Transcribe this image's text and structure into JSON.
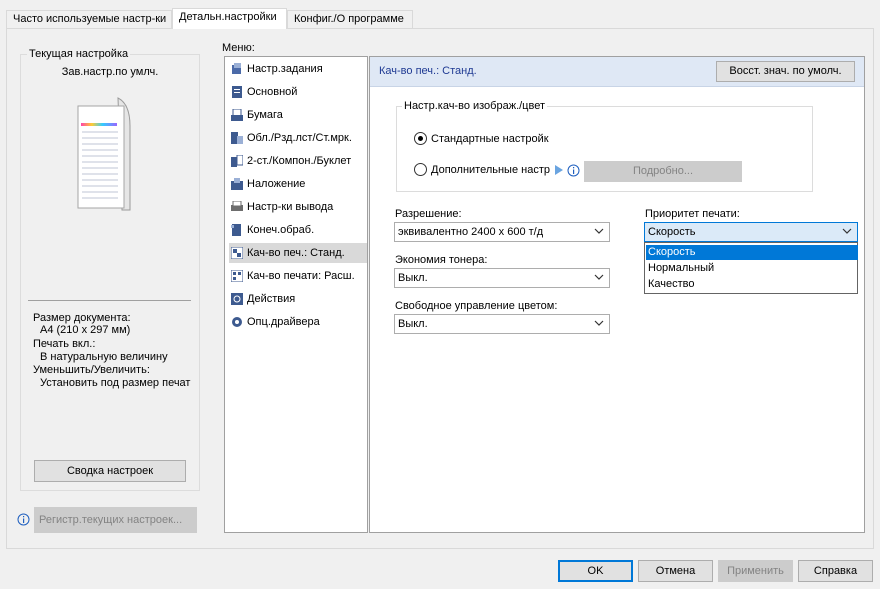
{
  "tabs": [
    {
      "label": "Часто используемые настр-ки",
      "active": false
    },
    {
      "label": "Детальн.настройки",
      "active": true
    },
    {
      "label": "Конфиг./О программе",
      "active": false
    }
  ],
  "left": {
    "current_setting_title": "Текущая настройка",
    "current_setting_value": "Зав.настр.по умлч.",
    "doc_size_label": "Размер документа:",
    "doc_size_value": "A4 (210 x 297 мм)",
    "print_label": "Печать вкл.:",
    "print_value": "В натуральную величину",
    "zoom_label": "Уменьшить/Увеличить:",
    "zoom_value": "Установить под размер печат",
    "summary_button": "Сводка настроек",
    "register_button": "Регистр.текущих настроек..."
  },
  "menu": {
    "title": "Меню:",
    "items": [
      {
        "label": "Настр.задания",
        "icon": "job-settings-icon"
      },
      {
        "label": "Основной",
        "icon": "basic-icon"
      },
      {
        "label": "Бумага",
        "icon": "paper-icon"
      },
      {
        "label": "Обл./Рзд.лст/Ст.мрк.",
        "icon": "cover-icon"
      },
      {
        "label": "2-ст./Компон./Буклет",
        "icon": "duplex-icon"
      },
      {
        "label": "Наложение",
        "icon": "overlay-icon"
      },
      {
        "label": "Настр-ки вывода",
        "icon": "output-icon"
      },
      {
        "label": "Конеч.обраб.",
        "icon": "finishing-icon"
      },
      {
        "label": "Кач-во печ.: Станд.",
        "icon": "quality-icon",
        "selected": true
      },
      {
        "label": "Кач-во печати: Расш.",
        "icon": "quality-adv-icon"
      },
      {
        "label": "Действия",
        "icon": "actions-icon"
      },
      {
        "label": "Опц.драйвера",
        "icon": "driver-options-icon"
      }
    ]
  },
  "content": {
    "header_title": "Кач-во печ.: Станд.",
    "restore_button": "Восст. знач. по умолч.",
    "image_quality_group": "Настр.кач-во изображ./цвет",
    "standard_radio": "Стандартные настройк",
    "advanced_radio": "Дополнительные настр",
    "details_button": "Подробно...",
    "resolution_label": "Разрешение:",
    "resolution_value": "эквивалентно 2400 x 600 т/д",
    "toner_label": "Экономия тонера:",
    "toner_value": "Выкл.",
    "color_label": "Свободное управление цветом:",
    "color_value": "Выкл.",
    "priority_label": "Приоритет печати:",
    "priority_value": "Скорость",
    "priority_options": [
      "Скорость",
      "Нормальный",
      "Качество"
    ]
  },
  "footer": {
    "ok": "OK",
    "cancel": "Отмена",
    "apply": "Применить",
    "help": "Справка"
  },
  "colors": {
    "header_bg": "#dfe8f5",
    "header_text": "#1f3a93",
    "selection": "#0078d7"
  }
}
